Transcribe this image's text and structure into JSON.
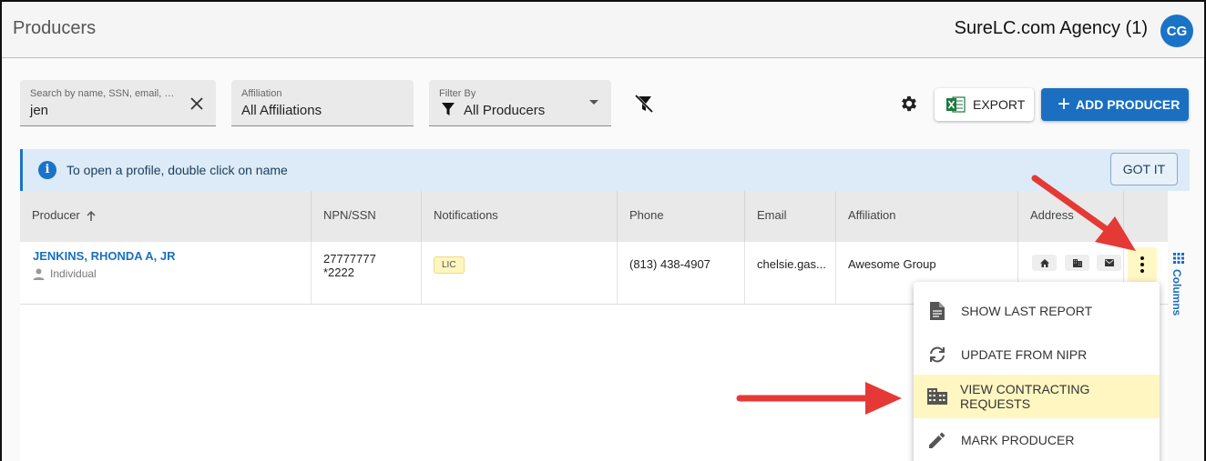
{
  "header": {
    "title": "Producers",
    "agency": "SureLC.com Agency (1)",
    "avatar_initials": "CG"
  },
  "toolbar": {
    "search": {
      "label": "Search by name, SSN, email, phone",
      "value": "jen"
    },
    "affiliation": {
      "label": "Affiliation",
      "value": "All Affiliations"
    },
    "filter": {
      "label": "Filter By",
      "value": "All Producers"
    },
    "export_label": "EXPORT",
    "add_label": "ADD PRODUCER"
  },
  "banner": {
    "text": "To open a profile, double click on name",
    "button": "GOT IT"
  },
  "table": {
    "columns": [
      "Producer",
      "NPN/SSN",
      "Notifications",
      "Phone",
      "Email",
      "Affiliation",
      "Address"
    ],
    "rows": [
      {
        "name": "JENKINS, RHONDA A, JR",
        "type": "Individual",
        "npn": "27777777",
        "ssn": "*2222",
        "notification": "LIC",
        "phone": "(813) 438-4907",
        "email": "chelsie.gas...",
        "affiliation": "Awesome Group"
      }
    ]
  },
  "columns_tab": "Columns",
  "menu": {
    "items": [
      {
        "label": "SHOW LAST REPORT",
        "icon": "document-icon"
      },
      {
        "label": "UPDATE FROM NIPR",
        "icon": "sync-icon"
      },
      {
        "label": "VIEW CONTRACTING REQUESTS",
        "icon": "building-icon",
        "highlighted": true
      },
      {
        "label": "MARK PRODUCER",
        "icon": "pencil-icon"
      }
    ]
  },
  "colors": {
    "primary": "#1a6fc0",
    "highlight": "#fff6c2",
    "arrow": "#e53935",
    "banner": "#dcebf7"
  }
}
